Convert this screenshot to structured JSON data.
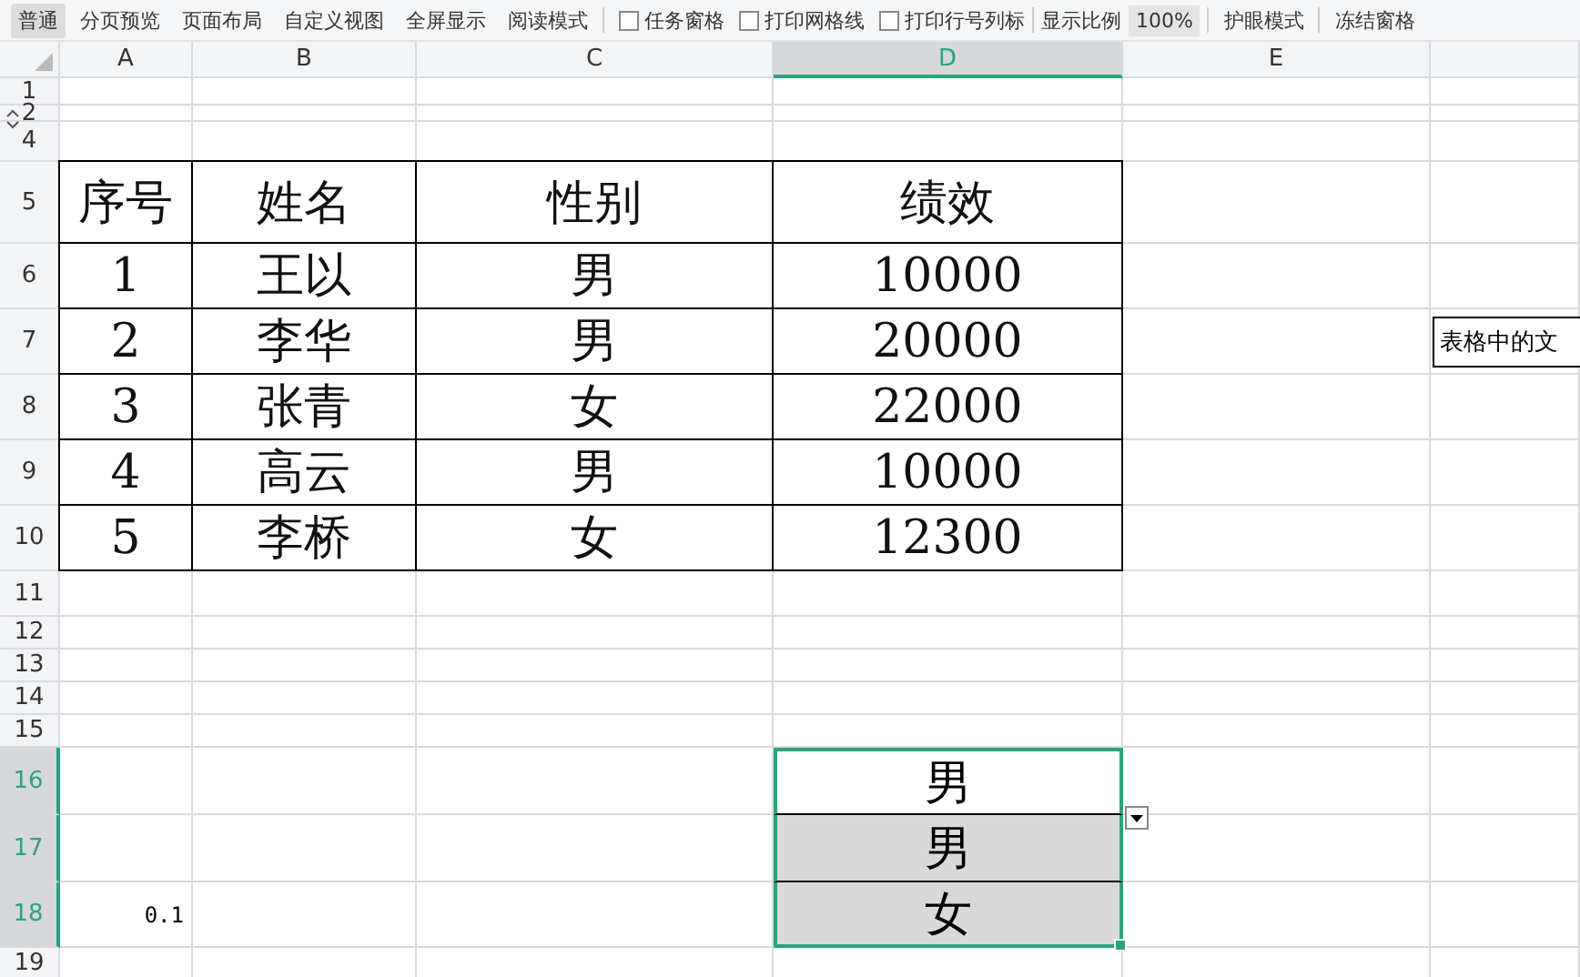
{
  "toolbar": {
    "views": [
      {
        "label": "普通",
        "selected": true
      },
      {
        "label": "分页预览",
        "selected": false
      },
      {
        "label": "页面布局",
        "selected": false
      },
      {
        "label": "自定义视图",
        "selected": false
      },
      {
        "label": "全屏显示",
        "selected": false
      },
      {
        "label": "阅读模式",
        "selected": false
      }
    ],
    "checkboxes": [
      {
        "label": "任务窗格",
        "checked": false
      },
      {
        "label": "打印网格线",
        "checked": false
      },
      {
        "label": "打印行号列标",
        "checked": false
      }
    ],
    "zoom_label": "显示比例",
    "zoom_value": "100%",
    "eye_mode": "护眼模式",
    "freeze": "冻结窗格"
  },
  "columns": [
    {
      "label": "A",
      "selected": false
    },
    {
      "label": "B",
      "selected": false
    },
    {
      "label": "C",
      "selected": false
    },
    {
      "label": "D",
      "selected": true
    },
    {
      "label": "E",
      "selected": false
    }
  ],
  "rows": [
    {
      "label": "1",
      "selected": false,
      "cells": []
    },
    {
      "label": "2",
      "selected": false,
      "cells": []
    },
    {
      "label": "4",
      "selected": false,
      "cells": []
    },
    {
      "label": "5",
      "selected": false,
      "cells": [
        {
          "kind": "table",
          "text": "序号"
        },
        {
          "kind": "table",
          "text": "姓名"
        },
        {
          "kind": "table",
          "text": "性别"
        },
        {
          "kind": "table",
          "text": "绩效"
        }
      ]
    },
    {
      "label": "6",
      "selected": false,
      "cells": [
        {
          "kind": "table",
          "text": "1"
        },
        {
          "kind": "table",
          "text": "王以"
        },
        {
          "kind": "table",
          "text": "男"
        },
        {
          "kind": "table",
          "text": "10000"
        }
      ]
    },
    {
      "label": "7",
      "selected": false,
      "cells": [
        {
          "kind": "table",
          "text": "2"
        },
        {
          "kind": "table",
          "text": "李华"
        },
        {
          "kind": "table",
          "text": "男"
        },
        {
          "kind": "table",
          "text": "20000"
        }
      ]
    },
    {
      "label": "8",
      "selected": false,
      "cells": [
        {
          "kind": "table",
          "text": "3"
        },
        {
          "kind": "table",
          "text": "张青"
        },
        {
          "kind": "table",
          "text": "女"
        },
        {
          "kind": "table",
          "text": "22000"
        }
      ]
    },
    {
      "label": "9",
      "selected": false,
      "cells": [
        {
          "kind": "table",
          "text": "4"
        },
        {
          "kind": "table",
          "text": "高云"
        },
        {
          "kind": "table",
          "text": "男"
        },
        {
          "kind": "table",
          "text": "10000"
        }
      ]
    },
    {
      "label": "10",
      "selected": false,
      "cells": [
        {
          "kind": "table",
          "text": "5"
        },
        {
          "kind": "table",
          "text": "李桥"
        },
        {
          "kind": "table",
          "text": "女"
        },
        {
          "kind": "table",
          "text": "12300"
        }
      ]
    },
    {
      "label": "11",
      "selected": false,
      "cells": []
    },
    {
      "label": "12",
      "selected": false,
      "cells": []
    },
    {
      "label": "13",
      "selected": false,
      "cells": []
    },
    {
      "label": "14",
      "selected": false,
      "cells": []
    },
    {
      "label": "15",
      "selected": false,
      "cells": []
    },
    {
      "label": "16",
      "selected": true,
      "cells": [
        {
          "kind": "empty"
        },
        {
          "kind": "empty"
        },
        {
          "kind": "empty"
        },
        {
          "kind": "picked",
          "text": "男",
          "selected": true,
          "active": true
        }
      ]
    },
    {
      "label": "17",
      "selected": true,
      "cells": [
        {
          "kind": "empty"
        },
        {
          "kind": "empty"
        },
        {
          "kind": "empty"
        },
        {
          "kind": "picked",
          "text": "男",
          "selected": true,
          "active": false
        }
      ]
    },
    {
      "label": "18",
      "selected": true,
      "cells": [
        {
          "kind": "number",
          "text": "0.1"
        },
        {
          "kind": "empty"
        },
        {
          "kind": "empty"
        },
        {
          "kind": "picked",
          "text": "女",
          "selected": true,
          "active": false
        }
      ]
    },
    {
      "label": "19",
      "selected": false,
      "cells": []
    }
  ],
  "comment": {
    "text": "表格中的文"
  }
}
